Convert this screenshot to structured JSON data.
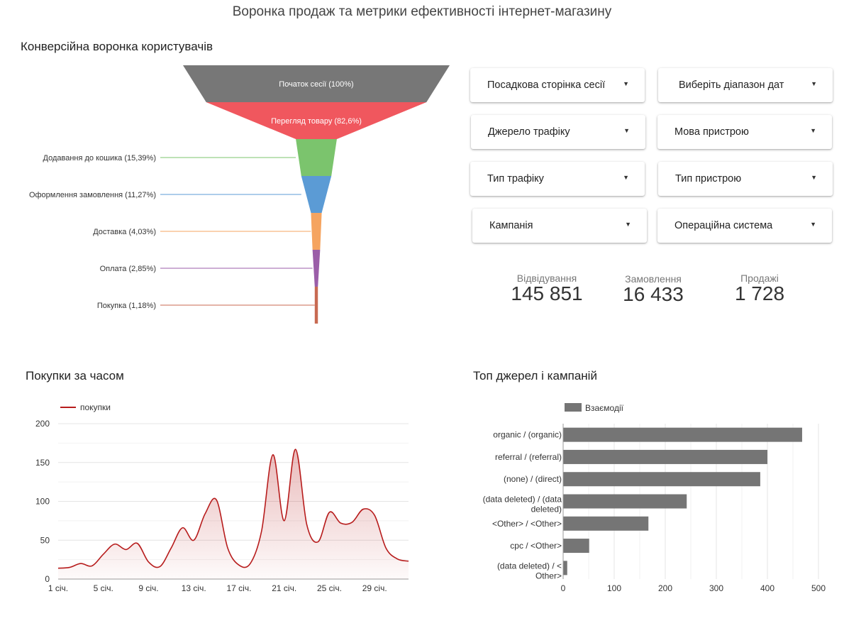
{
  "page": {
    "title": "Воронка продаж та метрики ефективності інтернет-магазину"
  },
  "funnel": {
    "title": "Конверсійна воронка користувачів",
    "stages": [
      {
        "label": "Початок сесії (100%)",
        "percent": 100,
        "color": "#777777",
        "label_inside": true
      },
      {
        "label": "Перегляд товару (82,6%)",
        "percent": 82.6,
        "color": "#f0575e",
        "label_inside": true
      },
      {
        "label": "Додавання до кошика (15,39%)",
        "percent": 15.39,
        "color": "#7bc46d",
        "label_inside": false
      },
      {
        "label": "Оформлення замовлення (11,27%)",
        "percent": 11.27,
        "color": "#5b9bd5",
        "label_inside": false
      },
      {
        "label": "Доставка (4,03%)",
        "percent": 4.03,
        "color": "#f5a460",
        "label_inside": false
      },
      {
        "label": "Оплата (2,85%)",
        "percent": 2.85,
        "color": "#9b5ea8",
        "label_inside": false
      },
      {
        "label": "Покупка (1,18%)",
        "percent": 1.18,
        "color": "#c86a52",
        "label_inside": false
      }
    ]
  },
  "filters": [
    {
      "label": "Посадкова сторінка сесії"
    },
    {
      "label": "Виберіть діапазон дат"
    },
    {
      "label": "Джерело трафіку"
    },
    {
      "label": "Мова пристрою"
    },
    {
      "label": "Тип трафіку"
    },
    {
      "label": "Тип пристрою"
    },
    {
      "label": "Кампанія"
    },
    {
      "label": "Операційна система"
    }
  ],
  "dropdown_arrow": "▼",
  "kpis": [
    {
      "label": "Відвідування",
      "value": "145 851"
    },
    {
      "label": "Замовлення",
      "value": "16 433"
    },
    {
      "label": "Продажі",
      "value": "1 728"
    }
  ],
  "chart_data": [
    {
      "type": "area",
      "title": "Покупки за часом",
      "legend": [
        "покупки"
      ],
      "legend_position": "top-left",
      "color": "#b71c1c",
      "ylim": [
        0,
        200
      ],
      "yticks": [
        0,
        50,
        100,
        150,
        200
      ],
      "xticks": [
        "1 січ.",
        "5 січ.",
        "9 січ.",
        "13 січ.",
        "17 січ.",
        "21 січ.",
        "25 січ.",
        "29 січ."
      ],
      "grid": true,
      "x": [
        1,
        2,
        3,
        4,
        5,
        6,
        7,
        8,
        9,
        10,
        11,
        12,
        13,
        14,
        15,
        16,
        17,
        18,
        19,
        20,
        21,
        22,
        23,
        24,
        25,
        26,
        27,
        28,
        29,
        30,
        31,
        32
      ],
      "series": [
        {
          "name": "покупки",
          "values": [
            14,
            15,
            20,
            17,
            32,
            45,
            38,
            46,
            22,
            16,
            40,
            66,
            50,
            84,
            102,
            40,
            18,
            20,
            62,
            160,
            75,
            167,
            70,
            48,
            86,
            72,
            73,
            90,
            82,
            40,
            26,
            23
          ]
        }
      ]
    },
    {
      "type": "bar",
      "orientation": "horizontal",
      "title": "Топ джерел і кампаній",
      "legend": [
        "Взаємодії"
      ],
      "legend_position": "top",
      "color": "#757575",
      "categories": [
        "organic / (organic)",
        "referral / (referral)",
        "(none) / (direct)",
        "(data deleted) / (data deleted)",
        "<Other> / <Other>",
        "cpc / <Other>",
        "(data deleted) / <Other>"
      ],
      "category_lines": [
        [
          "organic / (organic)"
        ],
        [
          "referral / (referral)"
        ],
        [
          "(none) / (direct)"
        ],
        [
          "(data deleted) / (data",
          "deleted)"
        ],
        [
          "<Other> / <Other>"
        ],
        [
          "cpc / <Other>"
        ],
        [
          "(data deleted) / <",
          "Other>"
        ]
      ],
      "series": [
        {
          "name": "Взаємодії",
          "values": [
            468,
            400,
            386,
            242,
            167,
            51,
            8
          ]
        }
      ],
      "xlim": [
        0,
        500
      ],
      "xticks": [
        0,
        100,
        200,
        300,
        400,
        500
      ],
      "grid": true
    }
  ]
}
